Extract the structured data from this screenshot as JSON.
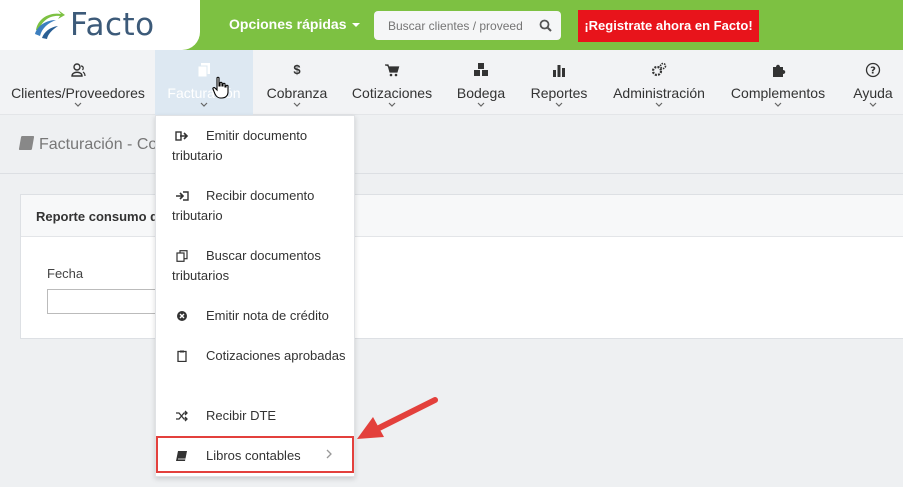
{
  "header": {
    "logo_text": "Facto",
    "quick_options_label": "Opciones rápidas",
    "search": {
      "placeholder": "Buscar clientes / proveed"
    },
    "register_label": "¡Registrate ahora en Facto!"
  },
  "menu": [
    {
      "label": "Clientes/Proveedores",
      "icon": "users-icon"
    },
    {
      "label": "Facturación",
      "icon": "document-copy-icon"
    },
    {
      "label": "Cobranza",
      "icon": "dollar-icon"
    },
    {
      "label": "Cotizaciones",
      "icon": "cart-icon"
    },
    {
      "label": "Bodega",
      "icon": "cubes-icon"
    },
    {
      "label": "Reportes",
      "icon": "bar-chart-icon"
    },
    {
      "label": "Administración",
      "icon": "cogs-icon"
    },
    {
      "label": "Complementos",
      "icon": "puzzle-icon"
    },
    {
      "label": "Ayuda",
      "icon": "question-circle-icon"
    }
  ],
  "breadcrumb": {
    "text": "Facturación - Co"
  },
  "panel": {
    "title": "Reporte consumo d",
    "field_label": "Fecha",
    "field_value": ""
  },
  "dropdown": [
    {
      "label": "Emitir documento tributario",
      "icon": "sign-out-icon"
    },
    {
      "label": "Recibir documento tributario",
      "icon": "sign-in-icon"
    },
    {
      "label": "Buscar documentos tributarios",
      "icon": "copy-icon"
    },
    {
      "label": "Emitir nota de crédito",
      "icon": "times-circle-icon"
    },
    {
      "label": "Cotizaciones aprobadas",
      "icon": "clipboard-icon"
    },
    {
      "label": "Recibir DTE",
      "icon": "random-icon"
    },
    {
      "label": "Libros contables",
      "icon": "book-icon"
    }
  ],
  "colors": {
    "brand_green": "#7dc142",
    "register_red": "#e8141b",
    "annotation_red": "#e3403c",
    "logo_blue": "#3c5a79"
  }
}
